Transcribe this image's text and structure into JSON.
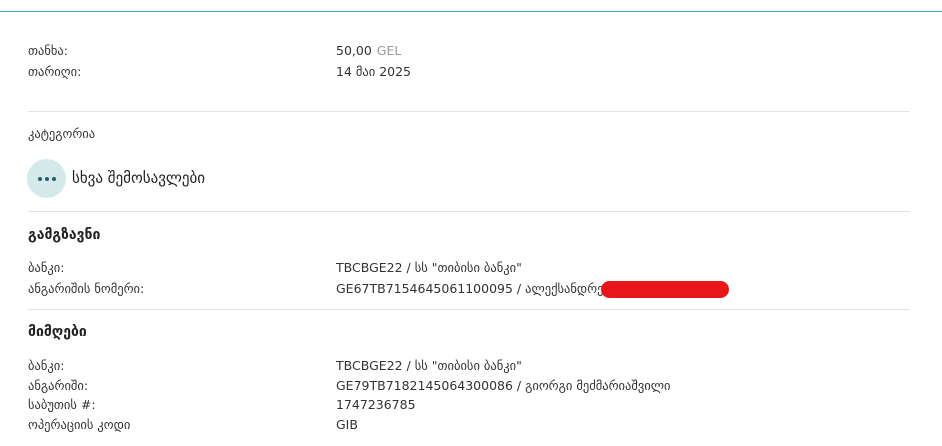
{
  "summary": {
    "amount_label": "თანხა:",
    "amount_value": "50,00",
    "amount_currency": "GEL",
    "date_label": "თარიღი:",
    "date_value": "14 მაი 2025"
  },
  "category": {
    "label": "კატეგორია",
    "icon": "more-dots-icon",
    "name": "სხვა შემოსავლები"
  },
  "sender": {
    "title": "გამგზავნი",
    "bank_label": "ბანკი:",
    "bank_value": "TBCBGE22 / სს \"თიბისი ბანკი\"",
    "account_label": "ანგარიშის ნომერი:",
    "account_value": "GE67TB7154645061100095 / ალექსანდრე"
  },
  "recipient": {
    "title": "მიმღები",
    "bank_label": "ბანკი:",
    "bank_value": "TBCBGE22 / სს \"თიბისი ბანკი\"",
    "account_label": "ანგარიში:",
    "account_value": "GE79TB7182145064300086 / გიორგი მეძმარიაშვილი",
    "doc_label": "საბუთის #:",
    "doc_value": "1747236785",
    "opcode_label": "ოპერაციის კოდი",
    "opcode_value": "GIB"
  },
  "colors": {
    "accent_line": "#3fb5c4",
    "icon_bg": "#d3e9ea",
    "redaction": "#e8151b"
  }
}
